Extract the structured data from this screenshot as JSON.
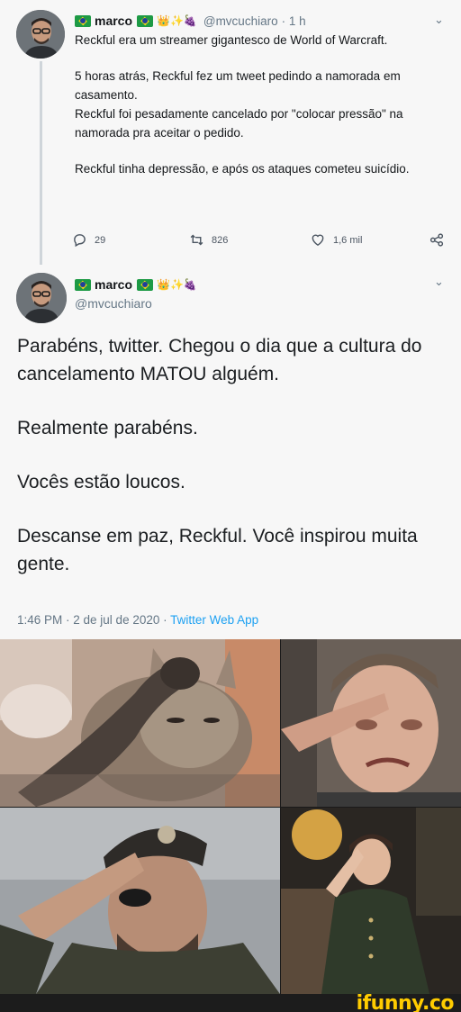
{
  "reply_tweet": {
    "display_name": "marco",
    "emojis": "👑✨🍇",
    "handle": "@mvcuchiaro",
    "time": "· 1 h",
    "lines": [
      "Reckful era um streamer gigantesco de World of Warcraft.",
      "5 horas atrás, Reckful fez um tweet pedindo a namorada em casamento.",
      "Reckful foi pesadamente cancelado por \"colocar pressão\" na namorada pra aceitar o pedido.",
      "Reckful tinha depressão, e após os ataques cometeu suicídio."
    ],
    "replies": "29",
    "retweets": "826",
    "likes": "1,6 mil"
  },
  "main_tweet": {
    "display_name": "marco",
    "emojis": "👑✨🍇",
    "handle": "@mvcuchiaro",
    "paragraphs": [
      "Parabéns, twitter. Chegou o dia que a cultura do cancelamento MATOU alguém.",
      "Realmente parabéns.",
      "Vocês estão loucos.",
      "Descanse em paz, Reckful. Você inspirou muita gente."
    ],
    "timestamp": "1:46 PM · 2 de jul de 2020 · ",
    "source": "Twitter Web App"
  },
  "memes": [
    "cat-salute",
    "crying-man-salute",
    "soldier-salute",
    "boy-salute"
  ],
  "watermark": "ifunny.co",
  "colors": {
    "link": "#1da1f2",
    "muted": "#657786",
    "background": "#f7f7f7"
  }
}
